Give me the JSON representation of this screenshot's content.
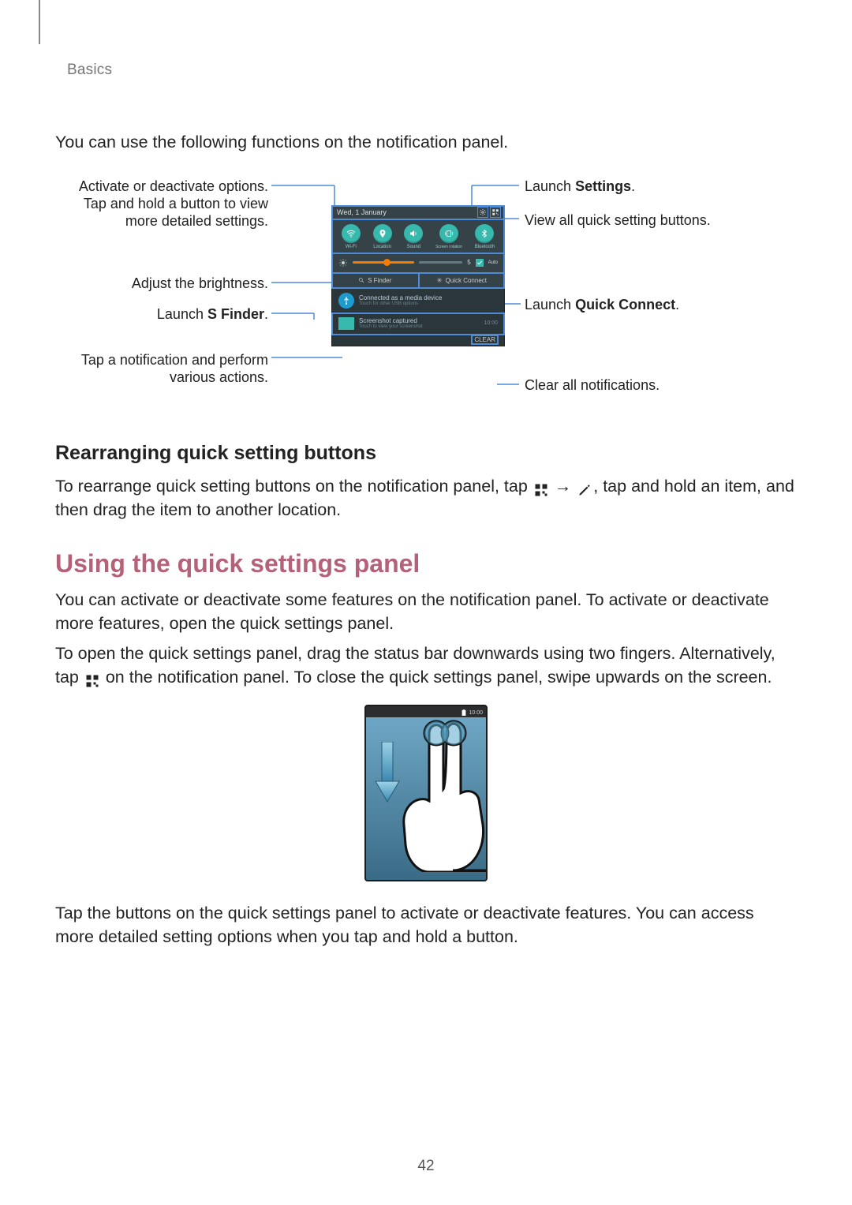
{
  "header": {
    "breadcrumb": "Basics"
  },
  "intro": "You can use the following functions on the notification panel.",
  "annotations": {
    "left": {
      "options": "Activate or deactivate options. Tap and hold a button to view more detailed settings.",
      "brightness": "Adjust the brightness.",
      "sfinder_pre": "Launch ",
      "sfinder_bold": "S Finder",
      "sfinder_post": ".",
      "notification_action": "Tap a notification and perform various actions."
    },
    "right": {
      "settings_pre": "Launch ",
      "settings_bold": "Settings",
      "settings_post": ".",
      "view_all": "View all quick setting buttons.",
      "quickconnect_pre": "Launch ",
      "quickconnect_bold": "Quick Connect",
      "quickconnect_post": ".",
      "clear": "Clear all notifications."
    }
  },
  "panel": {
    "date": "Wed, 1 January",
    "toggles": [
      "Wi-Fi",
      "Location",
      "Sound",
      "Screen rotation",
      "Bluetooth"
    ],
    "brightness_value": "5",
    "auto_label": "Auto",
    "sfinder": "S Finder",
    "quick_connect": "Quick Connect",
    "notifications": [
      {
        "title": "Connected as a media device",
        "sub": "Touch for other USB options"
      },
      {
        "title": "Screenshot captured",
        "sub": "Touch to view your screenshot",
        "time": "10:00"
      }
    ],
    "clear": "CLEAR"
  },
  "subheading_rearrange": "Rearranging quick setting buttons",
  "rearrange": {
    "pre": "To rearrange quick setting buttons on the notification panel, tap ",
    "arrow": " → ",
    "post": ", tap and hold an item, and then drag the item to another location."
  },
  "section_heading": "Using the quick settings panel",
  "para1": "You can activate or deactivate some features on the notification panel. To activate or deactivate more features, open the quick settings panel.",
  "para2_pre": "To open the quick settings panel, drag the status bar downwards using two fingers. Alternatively, tap ",
  "para2_post": " on the notification panel. To close the quick settings panel, swipe upwards on the screen.",
  "gesture_time": "10:00",
  "para3": "Tap the buttons on the quick settings panel to activate or deactivate features. You can access more detailed setting options when you tap and hold a button.",
  "page_number": "42"
}
